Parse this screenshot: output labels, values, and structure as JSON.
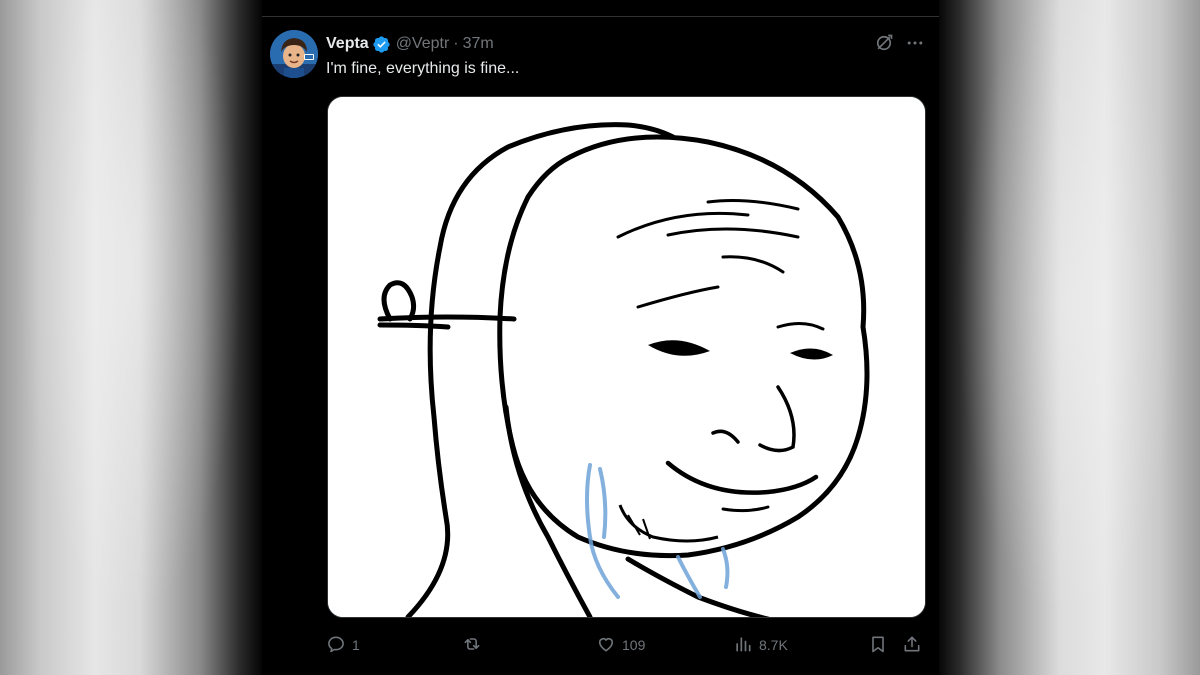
{
  "post": {
    "author_name": "Vepta",
    "author_handle": "@Veptr",
    "separator": "·",
    "time_ago": "37m",
    "text": "I'm fine, everything is fine...",
    "verified": true
  },
  "media": {
    "description_icon": "wojak-mask-meme-image"
  },
  "actions": {
    "reply_count": "1",
    "repost_count": "",
    "like_count": "109",
    "views_count": "8.7K"
  },
  "icons": {
    "grok": "grok-icon",
    "more": "more-icon",
    "reply": "reply-icon",
    "repost": "repost-icon",
    "like": "heart-icon",
    "views": "views-icon",
    "bookmark": "bookmark-icon",
    "share": "share-icon"
  },
  "colors": {
    "background": "#000000",
    "text_primary": "#e7e9ea",
    "text_secondary": "#71767b",
    "verified_blue": "#1d9bf0"
  }
}
